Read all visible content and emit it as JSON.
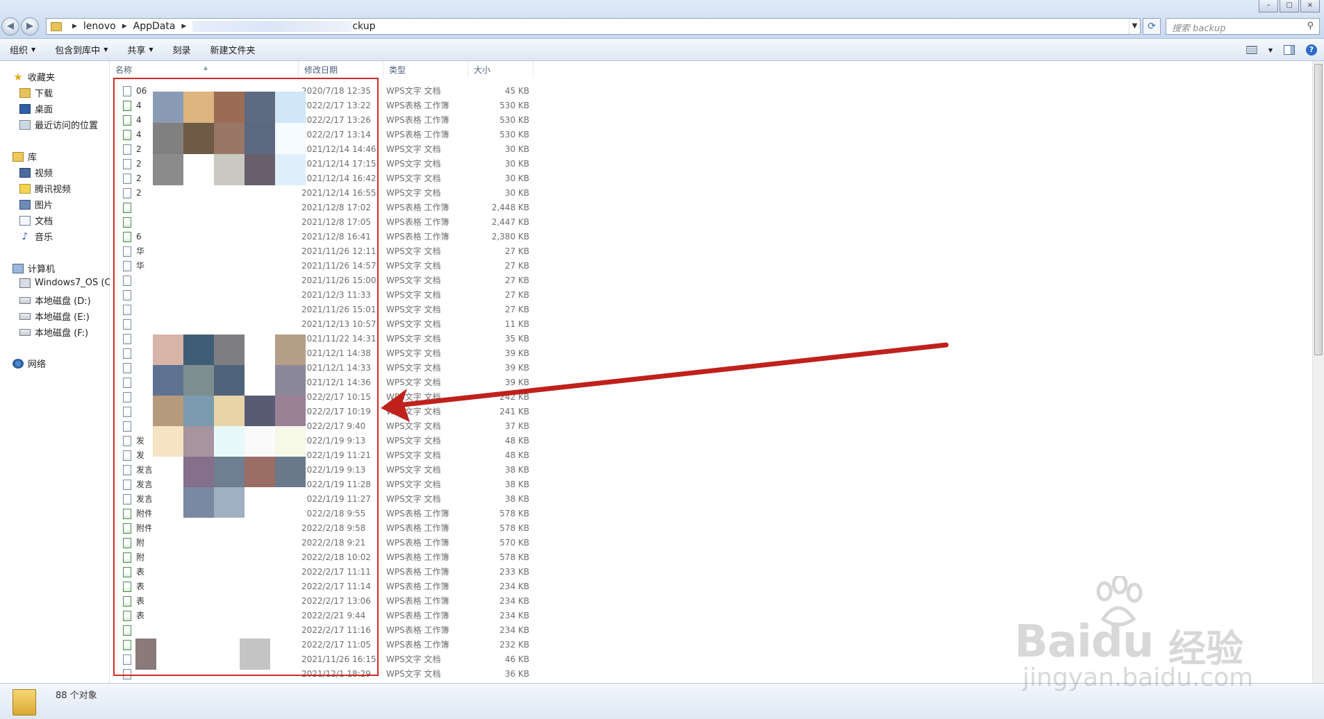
{
  "window": {
    "buttons": [
      "–",
      "▢",
      "×"
    ]
  },
  "address": {
    "crumbs": [
      "lenovo",
      "AppData",
      "ckup"
    ],
    "search_placeholder": "搜索 backup"
  },
  "toolbar": {
    "organize": "组织",
    "include_library": "包含到库中",
    "share": "共享",
    "burn": "刻录",
    "new_folder": "新建文件夹"
  },
  "nav": {
    "favorites": "收藏夹",
    "downloads": "下载",
    "desktop": "桌面",
    "recent": "最近访问的位置",
    "libraries": "库",
    "videos": "视频",
    "tencent_video": "腾讯视频",
    "pictures": "图片",
    "documents": "文档",
    "music": "音乐",
    "computer": "计算机",
    "drive_c": "Windows7_OS (C:)",
    "drive_d": "本地磁盘 (D:)",
    "drive_e": "本地磁盘 (E:)",
    "drive_f": "本地磁盘 (F:)",
    "network": "网络"
  },
  "columns": {
    "name": "名称",
    "date": "修改日期",
    "type": "类型",
    "size": "大小"
  },
  "files": [
    {
      "name": "06",
      "date": "2020/7/18 12:35",
      "type": "WPS文字 文档",
      "size": "45 KB",
      "kind": "doc"
    },
    {
      "name": "4",
      "date": "2022/2/17 13:22",
      "type": "WPS表格 工作簿",
      "size": "530 KB",
      "kind": "xls"
    },
    {
      "name": "4",
      "date": "2022/2/17 13:26",
      "type": "WPS表格 工作簿",
      "size": "530 KB",
      "kind": "xls"
    },
    {
      "name": "4",
      "date": "2022/2/17 13:14",
      "type": "WPS表格 工作簿",
      "size": "530 KB",
      "kind": "xls"
    },
    {
      "name": "2",
      "date": "2021/12/14 14:46",
      "type": "WPS文字 文档",
      "size": "30 KB",
      "kind": "doc"
    },
    {
      "name": "2",
      "date": "2021/12/14 17:15",
      "type": "WPS文字 文档",
      "size": "30 KB",
      "kind": "doc"
    },
    {
      "name": "2",
      "date": "2021/12/14 16:42",
      "type": "WPS文字 文档",
      "size": "30 KB",
      "kind": "doc"
    },
    {
      "name": "2",
      "date": "2021/12/14 16:55",
      "type": "WPS文字 文档",
      "size": "30 KB",
      "kind": "doc"
    },
    {
      "name": "",
      "date": "2021/12/8 17:02",
      "type": "WPS表格 工作簿",
      "size": "2,448 KB",
      "kind": "xls"
    },
    {
      "name": "",
      "date": "2021/12/8 17:05",
      "type": "WPS表格 工作簿",
      "size": "2,447 KB",
      "kind": "xls"
    },
    {
      "name": "6",
      "date": "2021/12/8 16:41",
      "type": "WPS表格 工作簿",
      "size": "2,380 KB",
      "kind": "xls"
    },
    {
      "name": "华",
      "date": "2021/11/26 12:11",
      "type": "WPS文字 文档",
      "size": "27 KB",
      "kind": "doc"
    },
    {
      "name": "华",
      "date": "2021/11/26 14:57",
      "type": "WPS文字 文档",
      "size": "27 KB",
      "kind": "doc"
    },
    {
      "name": "",
      "date": "2021/11/26 15:00",
      "type": "WPS文字 文档",
      "size": "27 KB",
      "kind": "doc"
    },
    {
      "name": "",
      "date": "2021/12/3 11:33",
      "type": "WPS文字 文档",
      "size": "27 KB",
      "kind": "doc"
    },
    {
      "name": "",
      "date": "2021/11/26 15:01",
      "type": "WPS文字 文档",
      "size": "27 KB",
      "kind": "doc"
    },
    {
      "name": "",
      "date": "2021/12/13 10:57",
      "type": "WPS文字 文档",
      "size": "11 KB",
      "kind": "doc"
    },
    {
      "name": "",
      "date": "2021/11/22 14:31",
      "type": "WPS文字 文档",
      "size": "35 KB",
      "kind": "doc"
    },
    {
      "name": "",
      "date": "2021/12/1 14:38",
      "type": "WPS文字 文档",
      "size": "39 KB",
      "kind": "doc"
    },
    {
      "name": "",
      "date": "2021/12/1 14:33",
      "type": "WPS文字 文档",
      "size": "39 KB",
      "kind": "doc"
    },
    {
      "name": "",
      "date": "2021/12/1 14:36",
      "type": "WPS文字 文档",
      "size": "39 KB",
      "kind": "doc"
    },
    {
      "name": "",
      "date": "2022/2/17 10:15",
      "type": "WPS文字 文档",
      "size": "242 KB",
      "kind": "doc"
    },
    {
      "name": "",
      "date": "2022/2/17 10:19",
      "type": "WPS文字 文档",
      "size": "241 KB",
      "kind": "doc"
    },
    {
      "name": "",
      "date": "2022/2/17 9:40",
      "type": "WPS文字 文档",
      "size": "37 KB",
      "kind": "doc"
    },
    {
      "name": "发",
      "date": "2022/1/19 9:13",
      "type": "WPS文字 文档",
      "size": "48 KB",
      "kind": "doc"
    },
    {
      "name": "发",
      "date": "2022/1/19 11:21",
      "type": "WPS文字 文档",
      "size": "48 KB",
      "kind": "doc"
    },
    {
      "name": "发言",
      "date": "2022/1/19 9:13",
      "type": "WPS文字 文档",
      "size": "38 KB",
      "kind": "doc"
    },
    {
      "name": "发言",
      "date": "2022/1/19 11:28",
      "type": "WPS文字 文档",
      "size": "38 KB",
      "kind": "doc"
    },
    {
      "name": "发言",
      "date": "2022/1/19 11:27",
      "type": "WPS文字 文档",
      "size": "38 KB",
      "kind": "doc"
    },
    {
      "name": "附件",
      "date": "2022/2/18 9:55",
      "type": "WPS表格 工作簿",
      "size": "578 KB",
      "kind": "xls"
    },
    {
      "name": "附件",
      "date": "2022/2/18 9:58",
      "type": "WPS表格 工作簿",
      "size": "578 KB",
      "kind": "xls"
    },
    {
      "name": "附",
      "date": "2022/2/18 9:21",
      "type": "WPS表格 工作簿",
      "size": "570 KB",
      "kind": "xls"
    },
    {
      "name": "附",
      "date": "2022/2/18 10:02",
      "type": "WPS表格 工作簿",
      "size": "578 KB",
      "kind": "xls"
    },
    {
      "name": "表",
      "date": "2022/2/17 11:11",
      "type": "WPS表格 工作簿",
      "size": "233 KB",
      "kind": "xls"
    },
    {
      "name": "表",
      "date": "2022/2/17 11:14",
      "type": "WPS表格 工作簿",
      "size": "234 KB",
      "kind": "xls"
    },
    {
      "name": "表",
      "date": "2022/2/17 13:06",
      "type": "WPS表格 工作簿",
      "size": "234 KB",
      "kind": "xls"
    },
    {
      "name": "表",
      "date": "2022/2/21 9:44",
      "type": "WPS表格 工作簿",
      "size": "234 KB",
      "kind": "xls"
    },
    {
      "name": "",
      "date": "2022/2/17 11:16",
      "type": "WPS表格 工作簿",
      "size": "234 KB",
      "kind": "xls"
    },
    {
      "name": "",
      "date": "2022/2/17 11:05",
      "type": "WPS表格 工作簿",
      "size": "232 KB",
      "kind": "xls"
    },
    {
      "name": "",
      "date": "2021/11/26 16:15",
      "type": "WPS文字 文档",
      "size": "46 KB",
      "kind": "doc"
    },
    {
      "name": "",
      "date": "2021/12/1 18:29",
      "type": "WPS文字 文档",
      "size": "36 KB",
      "kind": "doc"
    }
  ],
  "mosaic_colors": {
    "top": [
      "#8a9bb5",
      "#dbb47e",
      "#9c6b53",
      "#5d6a82",
      "#cfe7f7",
      "#808080",
      "#6f5a45",
      "#997666",
      "#5b6880",
      "#f6fbff",
      "#8b8b8b",
      "#ffffff",
      "#c9c9c1",
      "#685f6d",
      "#e0f0fa"
    ],
    "mid": [
      "#d7b4a7",
      "#3f5e75",
      "#7e7e82",
      "#ffffff",
      "#b59e88",
      "#5e7190",
      "#7d8e8f",
      "#4f627b",
      "#ffffff",
      "#8a8898",
      "#b59a7c",
      "#7b9bb0",
      "#e9d4a8",
      "#575b74",
      "#9b8196",
      "#f5e3c4",
      "#a6949f",
      "#e8f9fb",
      "#fafafa",
      "#f6f8e8",
      "#ffffff",
      "#84708a",
      "#6d7f90",
      "#9b6e65",
      "#6a7a8a",
      "#ffffff",
      "#7889a1",
      "#9fb0c2",
      "#ffffff",
      "#ffffff"
    ],
    "bottom": [
      "#8a7a7a",
      "#ffffff",
      "#c4c4c4"
    ]
  },
  "status": {
    "count": "88 个对象"
  },
  "watermark": {
    "brand": "Bai",
    "brand2": "du",
    "cn": "经验",
    "url": "jingyan.baidu.com"
  }
}
